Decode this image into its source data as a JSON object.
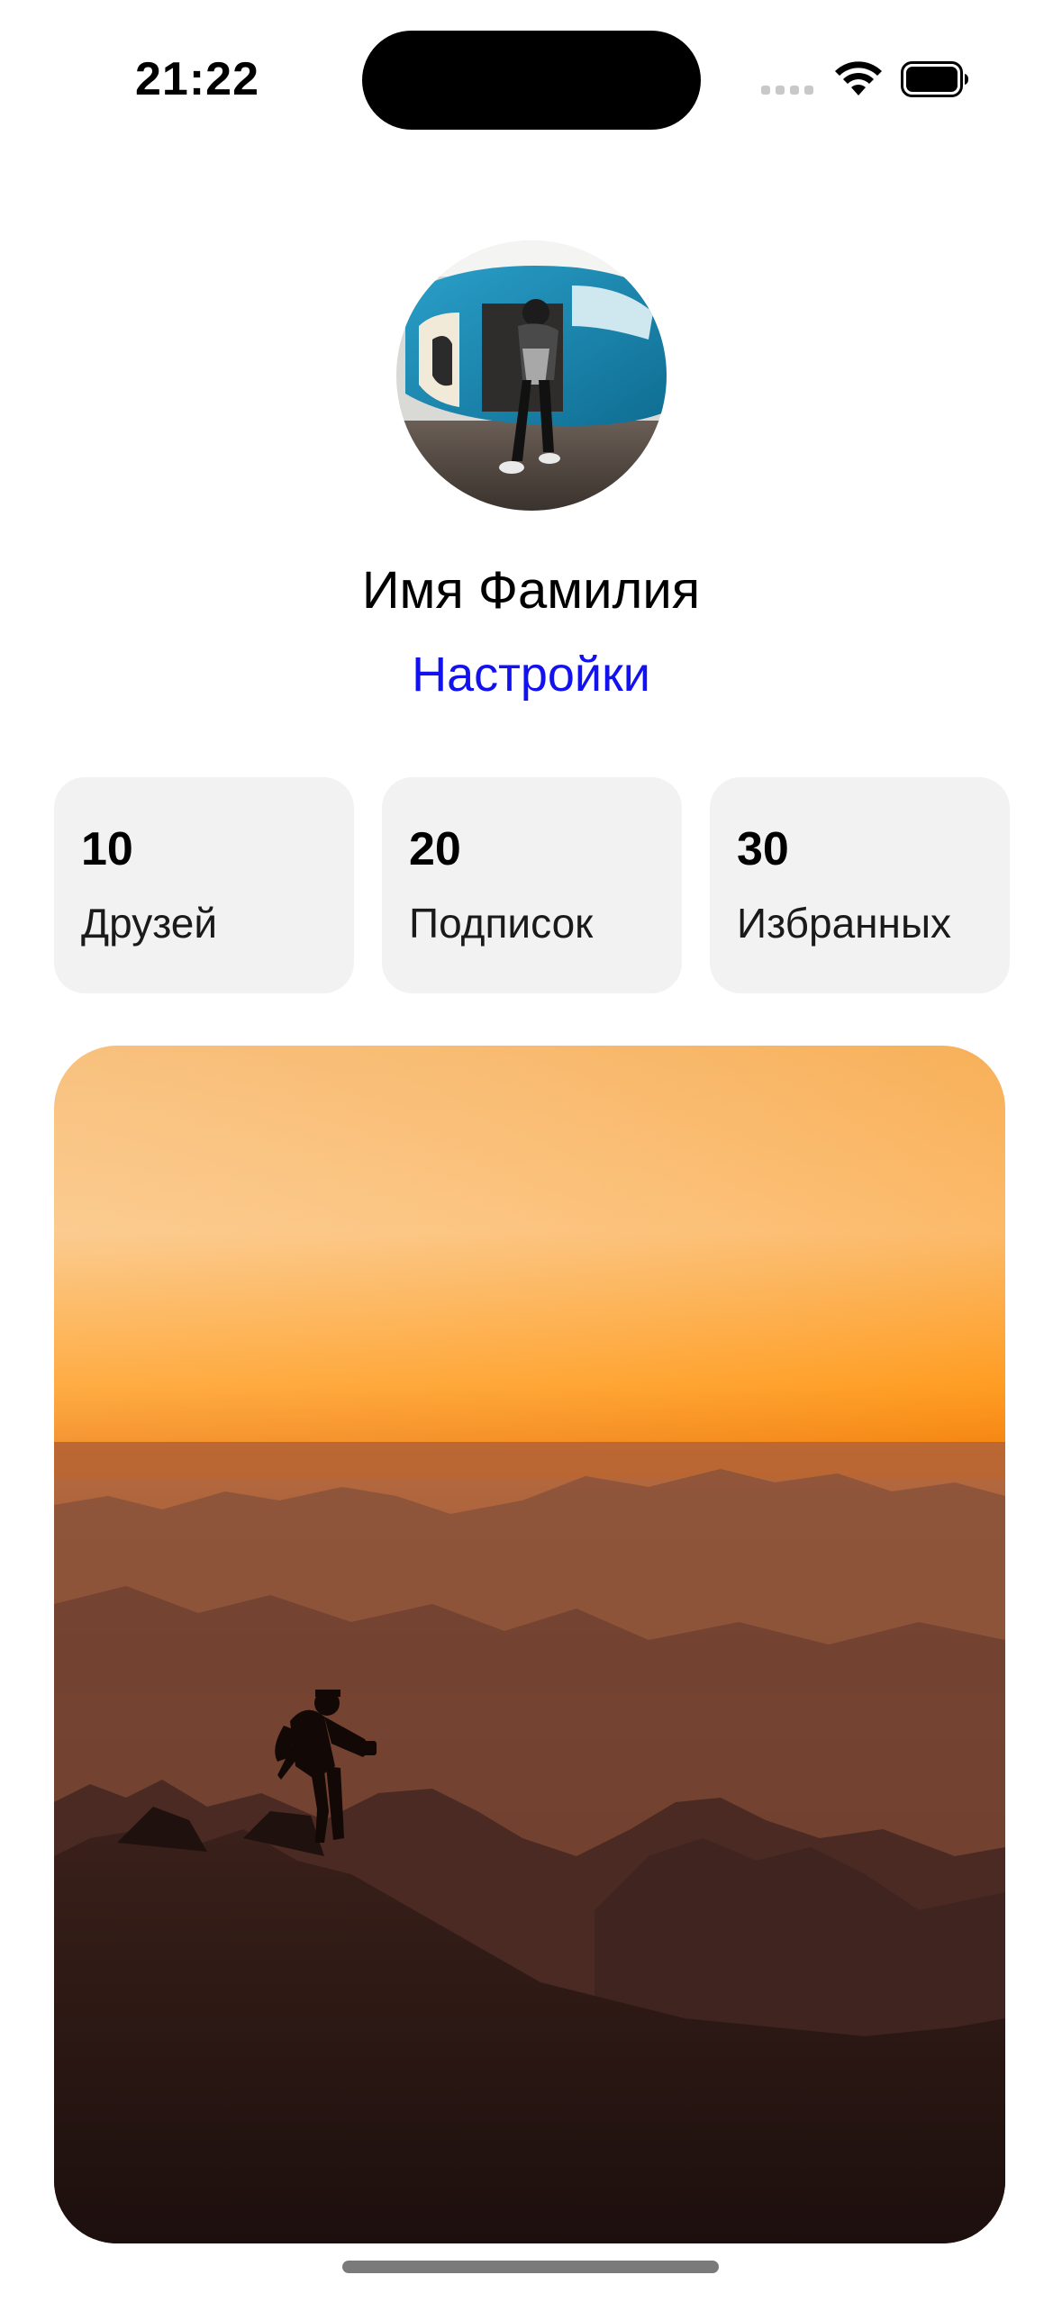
{
  "status_bar": {
    "time": "21:22",
    "icons": [
      "cellular-signal-icon",
      "wifi-icon",
      "battery-icon"
    ]
  },
  "profile": {
    "avatar": "avatar-photo",
    "name": "Имя Фамилия",
    "settings_label": "Настройки"
  },
  "stats": [
    {
      "value": "10",
      "label": "Друзей"
    },
    {
      "value": "20",
      "label": "Подписок"
    },
    {
      "value": "30",
      "label": "Избранных"
    }
  ],
  "photo": "featured-photo",
  "colors": {
    "link": "#1212f0",
    "card_background": "#f2f2f2",
    "text": "#000000"
  }
}
